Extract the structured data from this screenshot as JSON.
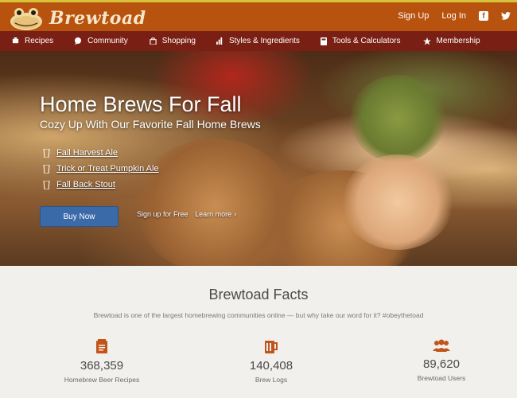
{
  "brand": {
    "name": "Brewtoad"
  },
  "top_links": {
    "signup": "Sign Up",
    "login": "Log In",
    "facebook_icon": "facebook-icon",
    "twitter_icon": "twitter-icon"
  },
  "nav": [
    {
      "label": "Recipes",
      "icon": "recipes-icon"
    },
    {
      "label": "Community",
      "icon": "community-icon"
    },
    {
      "label": "Shopping",
      "icon": "shopping-bag-icon"
    },
    {
      "label": "Styles & Ingredients",
      "icon": "bar-chart-icon"
    },
    {
      "label": "Tools & Calculators",
      "icon": "calculator-icon"
    },
    {
      "label": "Membership",
      "icon": "star-icon"
    }
  ],
  "hero": {
    "title": "Home Brews For Fall",
    "subtitle": "Cozy Up With Our Favorite Fall Home Brews",
    "brews": [
      "Fall Harvest Ale",
      "Trick or Treat Pumpkin Ale",
      "Fall Back Stout"
    ],
    "buy_label": "Buy Now",
    "signup_label": "Sign up for Free",
    "learn_label": "Learn more"
  },
  "facts": {
    "title": "Brewtoad Facts",
    "intro": "Brewtoad is one of the largest homebrewing communities online — but why take our word for it? #obeythetoad",
    "stats": [
      {
        "value": "368,359",
        "label": "Homebrew Beer Recipes",
        "icon": "recipe-notepad-icon"
      },
      {
        "value": "140,408",
        "label": "Brew Logs",
        "icon": "beer-mug-icon"
      },
      {
        "value": "89,620",
        "label": "Brewtoad Users",
        "icon": "users-icon"
      }
    ]
  },
  "colors": {
    "topbar": "#b8520f",
    "navbar": "#7a1f13",
    "accent_stripe": "#d8c23a",
    "button": "#3b6aa8",
    "facts_bg": "#f1f0ec",
    "stat_icon": "#c2541a"
  }
}
